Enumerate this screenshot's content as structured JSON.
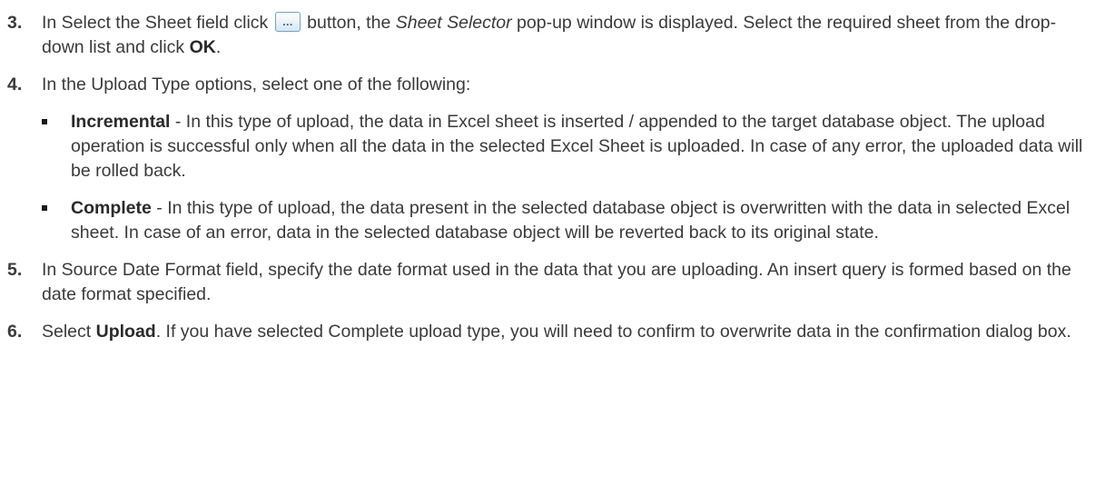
{
  "steps": [
    {
      "num": "3.",
      "parts": {
        "a": "In Select the Sheet field click ",
        "b": " button, the ",
        "c": "Sheet Selector",
        "d": " pop-up window is displayed. Select the required sheet from the drop-down list and click ",
        "e": "OK",
        "f": "."
      },
      "icon": "ellipsis-browse-button-icon",
      "icon_glyph": "…"
    },
    {
      "num": "4.",
      "text": "In the Upload Type options, select one of the following:",
      "bullets": [
        {
          "term": "Incremental",
          "text": " - In this type of upload, the data in Excel sheet is inserted / appended to the target database object. The upload operation is successful only when all the data in the selected Excel Sheet is uploaded. In case of any error, the uploaded data will be rolled back."
        },
        {
          "term": "Complete",
          "text": " - In this type of upload, the data present in the selected database object is overwritten with the data in selected Excel sheet. In case of an error, data in the selected database object will be reverted back to its original state."
        }
      ]
    },
    {
      "num": "5.",
      "text": "In Source Date Format field, specify the date format used in the data that you are uploading. An insert query is formed based on the date format specified."
    },
    {
      "num": "6.",
      "parts": {
        "a": "Select ",
        "b": "Upload",
        "c": ". If you have selected Complete upload type, you will need to confirm to overwrite data in the confirmation dialog box."
      }
    }
  ]
}
